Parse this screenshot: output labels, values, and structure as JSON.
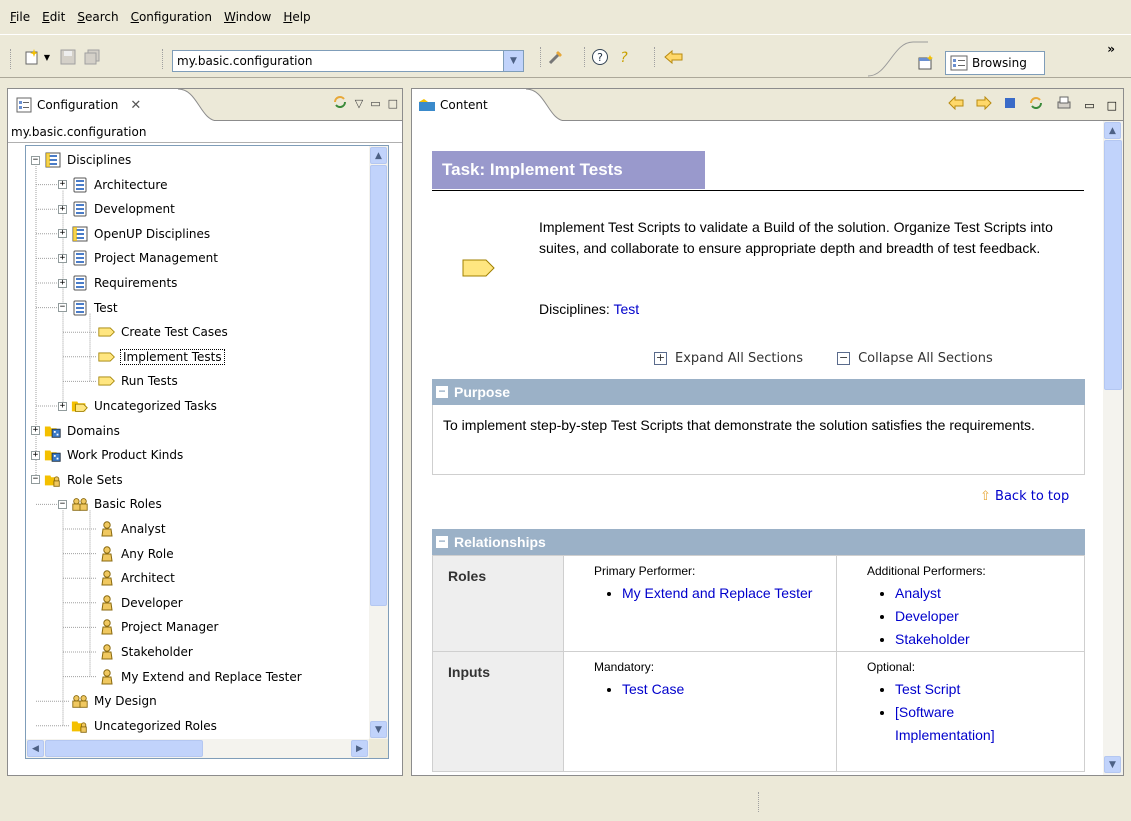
{
  "menu": [
    "File",
    "Edit",
    "Search",
    "Configuration",
    "Window",
    "Help"
  ],
  "toolbar": {
    "config_value": "my.basic.configuration",
    "perspective_label": "Browsing",
    "more_label": "»"
  },
  "config_view": {
    "tab_title": "Configuration",
    "path": "my.basic.configuration",
    "tree": [
      {
        "label": "Disciplines",
        "level": 0,
        "exp": "-",
        "icon": "discipline-group"
      },
      {
        "label": "Architecture",
        "level": 1,
        "exp": "+",
        "icon": "discipline"
      },
      {
        "label": "Development",
        "level": 1,
        "exp": "+",
        "icon": "discipline"
      },
      {
        "label": "OpenUP Disciplines",
        "level": 1,
        "exp": "+",
        "icon": "discipline-group"
      },
      {
        "label": "Project Management",
        "level": 1,
        "exp": "+",
        "icon": "discipline"
      },
      {
        "label": "Requirements",
        "level": 1,
        "exp": "+",
        "icon": "discipline"
      },
      {
        "label": "Test",
        "level": 1,
        "exp": "-",
        "icon": "discipline"
      },
      {
        "label": "Create Test Cases",
        "level": 2,
        "exp": "",
        "icon": "task"
      },
      {
        "label": "Implement Tests",
        "level": 2,
        "exp": "",
        "icon": "task",
        "selected": true
      },
      {
        "label": "Run Tests",
        "level": 2,
        "exp": "",
        "icon": "task"
      },
      {
        "label": "Uncategorized Tasks",
        "level": 1,
        "exp": "+",
        "icon": "task-folder"
      },
      {
        "label": "Domains",
        "level": 0,
        "exp": "+",
        "icon": "domain"
      },
      {
        "label": "Work Product Kinds",
        "level": 0,
        "exp": "+",
        "icon": "domain"
      },
      {
        "label": "Role Sets",
        "level": 0,
        "exp": "-",
        "icon": "role-folder"
      },
      {
        "label": "Basic Roles",
        "level": 1,
        "exp": "-",
        "icon": "role-set"
      },
      {
        "label": "Analyst",
        "level": 2,
        "exp": "",
        "icon": "role"
      },
      {
        "label": "Any Role",
        "level": 2,
        "exp": "",
        "icon": "role"
      },
      {
        "label": "Architect",
        "level": 2,
        "exp": "",
        "icon": "role"
      },
      {
        "label": "Developer",
        "level": 2,
        "exp": "",
        "icon": "role"
      },
      {
        "label": "Project Manager",
        "level": 2,
        "exp": "",
        "icon": "role"
      },
      {
        "label": "Stakeholder",
        "level": 2,
        "exp": "",
        "icon": "role"
      },
      {
        "label": "My Extend and Replace Tester",
        "level": 2,
        "exp": "",
        "icon": "role"
      },
      {
        "label": "My Design",
        "level": 1,
        "exp": "",
        "icon": "role-set"
      },
      {
        "label": "Uncategorized Roles",
        "level": 1,
        "exp": "",
        "icon": "role-folder"
      }
    ]
  },
  "content_view": {
    "tab_title": "Content",
    "task_title": "Task: Implement Tests",
    "description": "Implement Test Scripts to validate a Build of the solution. Organize Test Scripts into suites, and collaborate to ensure appropriate depth and breadth of test feedback.",
    "disciplines_label": "Disciplines:",
    "disciplines_link": "Test",
    "expand_all": "Expand All Sections",
    "collapse_all": "Collapse All Sections",
    "purpose_heading": "Purpose",
    "purpose_text": "To implement step-by-step Test Scripts that demonstrate the solution satisfies the requirements.",
    "back_to_top": "Back to top",
    "relationships_heading": "Relationships",
    "roles": {
      "heading": "Roles",
      "primary_label": "Primary Performer:",
      "primary": [
        "My Extend and Replace Tester"
      ],
      "additional_label": "Additional Performers:",
      "additional": [
        "Analyst",
        "Developer",
        "Stakeholder"
      ]
    },
    "inputs": {
      "heading": "Inputs",
      "mandatory_label": "Mandatory:",
      "mandatory": [
        "Test Case"
      ],
      "optional_label": "Optional:",
      "optional": [
        "Test Script",
        "[Software Implementation]"
      ]
    }
  },
  "colors": {
    "task_banner": "#9999cc",
    "section_header": "#9bb1c7",
    "link": "#0000cc"
  }
}
